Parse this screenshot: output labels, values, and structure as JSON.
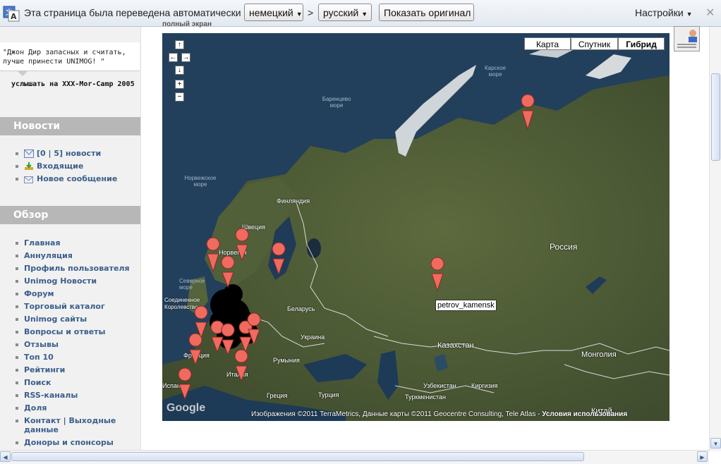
{
  "translate_bar": {
    "message": "Эта страница была переведена автоматически",
    "source_lang": "немецкий",
    "arrow": ">",
    "target_lang": "русский",
    "show_original": "Показать оригинал",
    "settings": "Настройки",
    "close": "✕"
  },
  "top_cut_label": "полный экран",
  "sidebar": {
    "quote": "\"Джон Дир запасных и считать, лучше принести UNIMOG! \"",
    "quote_source": "услышать на XXX-Mor-Camp 2005",
    "news_title": "Новости",
    "news_items": [
      {
        "label": "[0 | 5] новости",
        "icon": "mail-icon"
      },
      {
        "label": "Входящие",
        "icon": "inbox-download-icon"
      },
      {
        "label": "Новое сообщение",
        "icon": "new-message-icon"
      }
    ],
    "overview_title": "Обзор",
    "nav_items": [
      "Главная",
      "Аннуляция",
      "Профиль пользователя",
      "Unimog Новости",
      "Форум",
      "Торговый каталог",
      "Unimog сайты",
      "Вопросы и ответы",
      "Отзывы",
      "Топ 10",
      "Рейтинги",
      "Поиск",
      "RSS-каналы",
      "Доля",
      "Контакт | Выходные данные",
      "Доноры и спонсоры"
    ]
  },
  "map": {
    "types": [
      "Карта",
      "Спутник",
      "Гибрид"
    ],
    "active_type": "Гибрид",
    "controls": {
      "up": "↑",
      "left": "←",
      "right": "→",
      "down": "↓",
      "zoom_in": "+",
      "zoom_out": "−"
    },
    "labels": {
      "russia": "Россия",
      "kazakhstan": "Казахстан",
      "mongolia": "Монголия",
      "china": "Китай",
      "finland": "Финляндия",
      "sweden": "Швеция",
      "norway": "Норвегия",
      "belarus": "Беларусь",
      "ukraine": "Украина",
      "romania": "Румыния",
      "italy": "Италия",
      "spain": "Испания",
      "france": "Франция",
      "greece": "Греция",
      "turkey": "Турция",
      "uzbekistan": "Узбекистан",
      "kyrgyzstan": "Киргизия",
      "turkmenistan": "Туркменистан",
      "uk": "Соединенное Королевство",
      "barents_sea": "Баренцево море",
      "kara_sea": "Карское море",
      "norwegian_sea": "Норвежское море",
      "north_sea": "Северное море"
    },
    "tooltip": "petrov_kamensk",
    "attribution": "Изображения ©2011 TerraMetrics, Данные карты ©2011 Geocentre Consulting, Tele Atlas - ",
    "attribution_terms": "Условия использования",
    "logo": "Google"
  }
}
